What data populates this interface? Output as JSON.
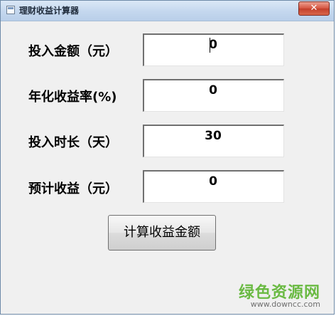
{
  "window": {
    "title": "理财收益计算器",
    "close_glyph": "✕"
  },
  "form": {
    "rows": [
      {
        "label": "投入金额（元）",
        "value": "0"
      },
      {
        "label": "年化收益率(%)",
        "value": "0"
      },
      {
        "label": "投入时长（天）",
        "value": "30"
      },
      {
        "label": "预计收益（元）",
        "value": "0"
      }
    ],
    "calculate_label": "计算收益金额"
  },
  "watermark": {
    "logo": "绿色资源网",
    "url": "www.downcc.com"
  },
  "colors": {
    "watermark_green": "#6aba43",
    "titlebar": "#c4d7ee",
    "close_red": "#c33f2b"
  }
}
